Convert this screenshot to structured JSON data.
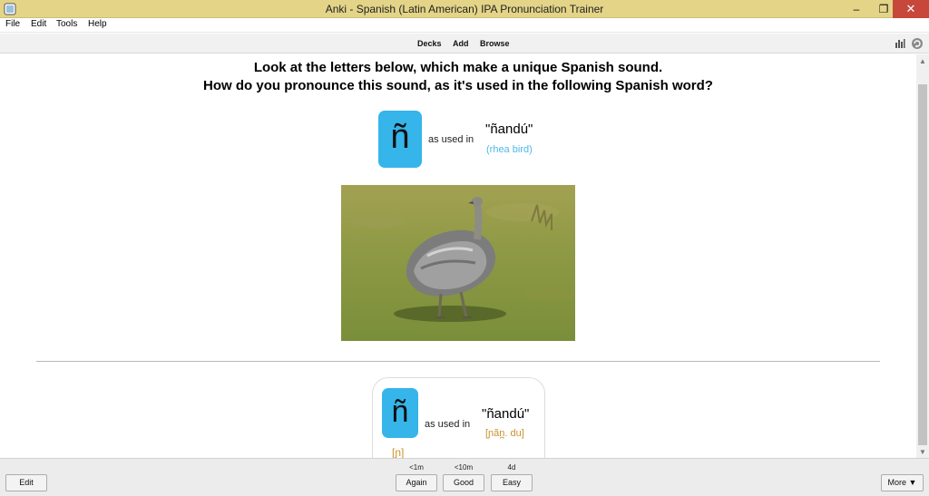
{
  "window": {
    "title": "Anki - Spanish (Latin American) IPA Pronunciation Trainer",
    "minimize_glyph": "–",
    "restore_glyph": "❐",
    "close_glyph": "✕"
  },
  "menu": [
    "File",
    "Edit",
    "Tools",
    "Help"
  ],
  "toolbar": {
    "decks": "Decks",
    "add": "Add",
    "browse": "Browse",
    "icons": [
      "stats-icon",
      "sync-icon"
    ]
  },
  "card": {
    "question_line1": "Look at the letters below, which make a unique Spanish sound.",
    "question_line2": "How do you pronounce this sound, as it's used in the following Spanish word?",
    "letter": "ñ",
    "as_used_in": "as used in",
    "word": "\"ñandú\"",
    "gloss": "(rhea bird)",
    "answer": {
      "letter": "ñ",
      "as_used_in": "as used in",
      "word": "\"ñandú\"",
      "ipa_word": "[ɲãn̪. du]",
      "ipa_sound": "[ɲ]"
    }
  },
  "bottom": {
    "edit": "Edit",
    "again": "Again",
    "good": "Good",
    "easy": "Easy",
    "more": "More ▼",
    "intervals": {
      "again": "<1m",
      "good": "<10m",
      "easy": "4d"
    }
  },
  "scrollbar": {
    "up_glyph": "▲",
    "down_glyph": "▼"
  },
  "colors": {
    "titlebar": "#e3d488",
    "tile": "#35b5ea",
    "gloss": "#4fb7e8",
    "ipa": "#c9922a",
    "close": "#c7473b"
  }
}
